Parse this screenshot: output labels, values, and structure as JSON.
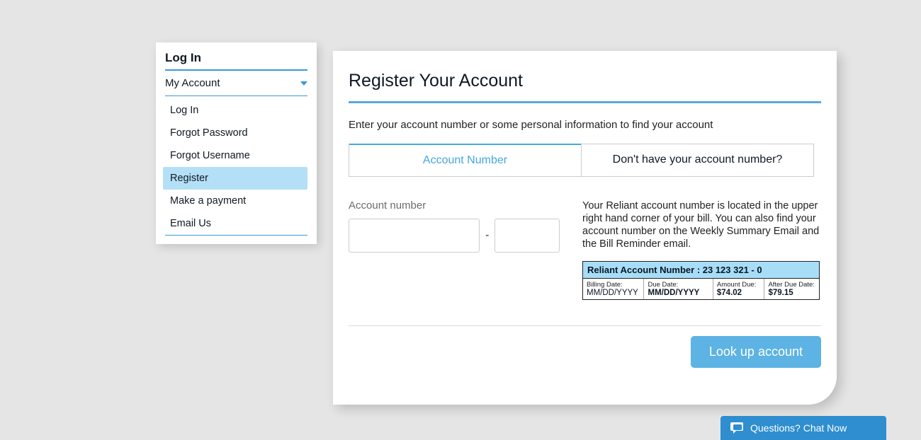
{
  "sidebar": {
    "title": "Log In",
    "section": "My Account",
    "items": [
      {
        "label": "Log In",
        "active": false
      },
      {
        "label": "Forgot Password",
        "active": false
      },
      {
        "label": "Forgot Username",
        "active": false
      },
      {
        "label": "Register",
        "active": true
      },
      {
        "label": "Make a payment",
        "active": false
      },
      {
        "label": "Email Us",
        "active": false
      }
    ]
  },
  "main": {
    "title": "Register Your Account",
    "instruction": "Enter your account number or some personal information to find your account",
    "tabs": {
      "account_number": "Account Number",
      "no_account": "Don't have your account number?"
    },
    "form": {
      "account_label": "Account number",
      "dash": "-",
      "account_main_value": "",
      "account_suffix_value": ""
    },
    "help_text": "Your Reliant account number is located in the upper right hand corner of your bill. You can also find your account number on the Weekly Summary Email and the Bill Reminder email.",
    "bill_example": {
      "header": "Reliant Account Number : 23 123 321 - 0",
      "billing_date_label": "Billing Date:",
      "billing_date_value": "MM/DD/YYYY",
      "due_date_label": "Due Date:",
      "due_date_value": "MM/DD/YYYY",
      "amount_due_label": "Amount Due:",
      "amount_due_value": "$74.02",
      "after_due_label": "After Due Date:",
      "after_due_value": "$79.15"
    },
    "lookup_button": "Look up account"
  },
  "chat": {
    "text": "Questions? Chat Now"
  }
}
